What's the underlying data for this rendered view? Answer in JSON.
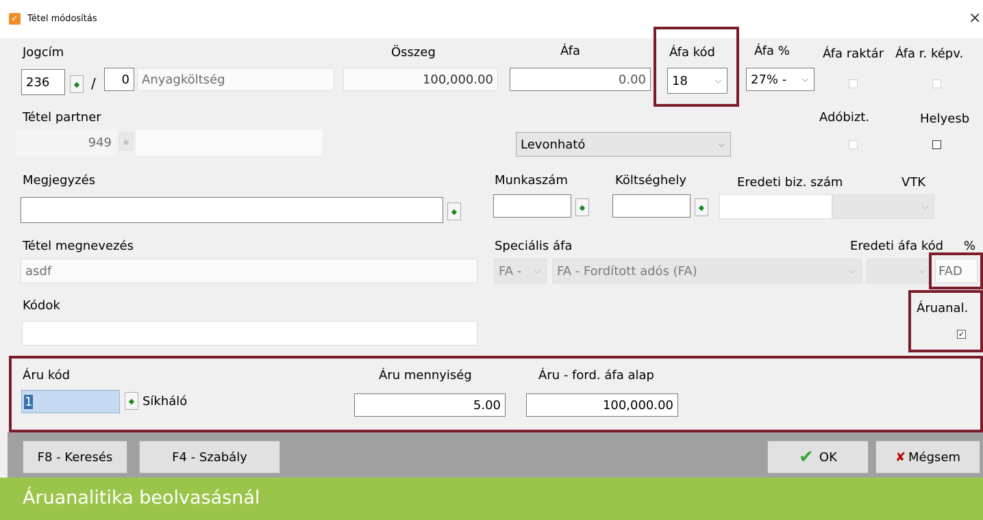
{
  "window": {
    "title": "Tétel módosítás",
    "close": "×"
  },
  "labels": {
    "jogcim": "Jogcím",
    "osszeg": "Összeg",
    "afa": "Áfa",
    "afa_kod": "Áfa kód",
    "afa_pct": "Áfa %",
    "afa_raktar": "Áfa raktár",
    "afa_r_kepv": "Áfa r. képv.",
    "tetel_partner": "Tétel partner",
    "adobizt": "Adóbizt.",
    "helyesb": "Helyesb",
    "megjegyzes": "Megjegyzés",
    "munkaszam": "Munkaszám",
    "koltseghely": "Költséghely",
    "eredeti_biz_szam": "Eredeti biz. szám",
    "vtk": "VTK",
    "tetel_megnevezes": "Tétel megnevezés",
    "specialis_afa": "Speciális áfa",
    "eredeti_afa_kod": "Eredeti áfa kód",
    "pct": "%",
    "kodok": "Kódok",
    "aruanal": "Áruanal.",
    "aru_kod": "Áru kód",
    "aru_mennyiseg": "Áru mennyiség",
    "aru_ford_afa_alap": "Áru - ford. áfa alap"
  },
  "fields": {
    "jogcim_code": "236",
    "jogcim_sep": "/",
    "jogcim_sub": "0",
    "jogcim_name": "Anyagköltség",
    "osszeg": "100,000.00",
    "afa": "0.00",
    "afa_kod": "18",
    "afa_pct": "27% -",
    "partner_code": "949",
    "partner_name": "",
    "levonhato": "Levonható",
    "megjegyzes": "",
    "munkaszam": "",
    "koltseghely": "",
    "eredeti_biz_szam": "",
    "tetel_megnevezes": "asdf",
    "spec_afa_code": "FA -",
    "spec_afa_name": "FA - Fordított adós (FA)",
    "eredeti_afa_kod_value": "",
    "fad": "FAD",
    "kodok": "",
    "aru_kod": "1",
    "aru_name": "Síkháló",
    "aru_mennyiseg": "5.00",
    "aru_ford_afa_alap": "100,000.00"
  },
  "checkboxes": {
    "afa_raktar": false,
    "afa_r_kepv": false,
    "adobizt": false,
    "helyesb": false,
    "aruanal": true
  },
  "buttons": {
    "f8": "F8 - Keresés",
    "f4": "F4 - Szabály",
    "ok": "OK",
    "cancel": "Mégsem"
  },
  "caption": "Áruanalitika beolvasásnál",
  "colors": {
    "highlight": "#7b1c2a",
    "caption_bg": "#9bc54a",
    "footer_bg": "#a0a0a0",
    "ok_check": "#3aa33a",
    "cancel_x": "#c00000"
  }
}
